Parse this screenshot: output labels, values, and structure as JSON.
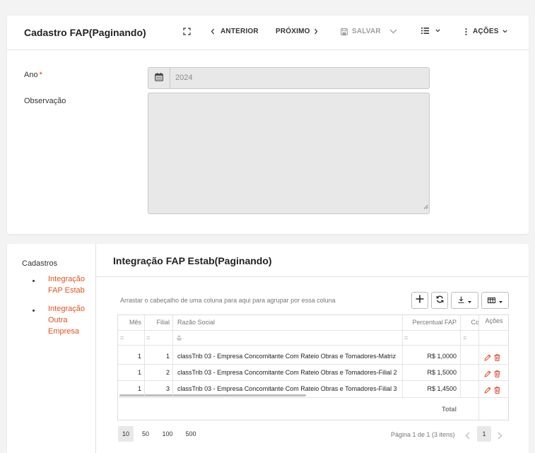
{
  "header": {
    "title": "Cadastro FAP(Paginando)",
    "prev_label": "ANTERIOR",
    "next_label": "PRÓXIMO",
    "save_label": "SALVAR",
    "actions_label": "AÇÕES"
  },
  "form": {
    "ano_label": "Ano",
    "ano_required_mark": "*",
    "ano_value": "2024",
    "obs_label": "Observação",
    "obs_value": ""
  },
  "sidebar": {
    "title": "Cadastros",
    "items": [
      {
        "label": "Integração FAP Estab"
      },
      {
        "label": "Integração Outra Empresa"
      }
    ]
  },
  "detail": {
    "title": "Integração FAP Estab(Paginando)",
    "drag_hint": "Arrastar o cabeçalho de uma coluna para aqui para agrupar por essa coluna"
  },
  "grid": {
    "columns": [
      "Mês",
      "Filial",
      "Razão Social",
      "Percentual FAP",
      "Co",
      "Ações"
    ],
    "rows": [
      {
        "mes": "1",
        "filial": "1",
        "razao": "classTrib 03 - Empresa Concomitante Com Rateio Obras e Tomadores-Matriz",
        "percentual": "R$ 1,0000"
      },
      {
        "mes": "1",
        "filial": "2",
        "razao": "classTrib 03 - Empresa Concomitante Com Rateio Obras e Tomadores-Filial 2",
        "percentual": "R$ 1,5000"
      },
      {
        "mes": "1",
        "filial": "3",
        "razao": "classTrib 03 - Empresa Concomitante Com Rateio Obras e Tomadores-Filial 3",
        "percentual": "R$ 1,4500"
      }
    ],
    "total_label": "Total"
  },
  "pager": {
    "sizes": [
      "10",
      "50",
      "100",
      "500"
    ],
    "selected_size": "10",
    "info": "Página 1 de 1 (3 itens)",
    "current_page": "1"
  },
  "colors": {
    "accent": "#e0531e",
    "required": "#e0301e",
    "disabled_field": "#e8e8e8"
  }
}
